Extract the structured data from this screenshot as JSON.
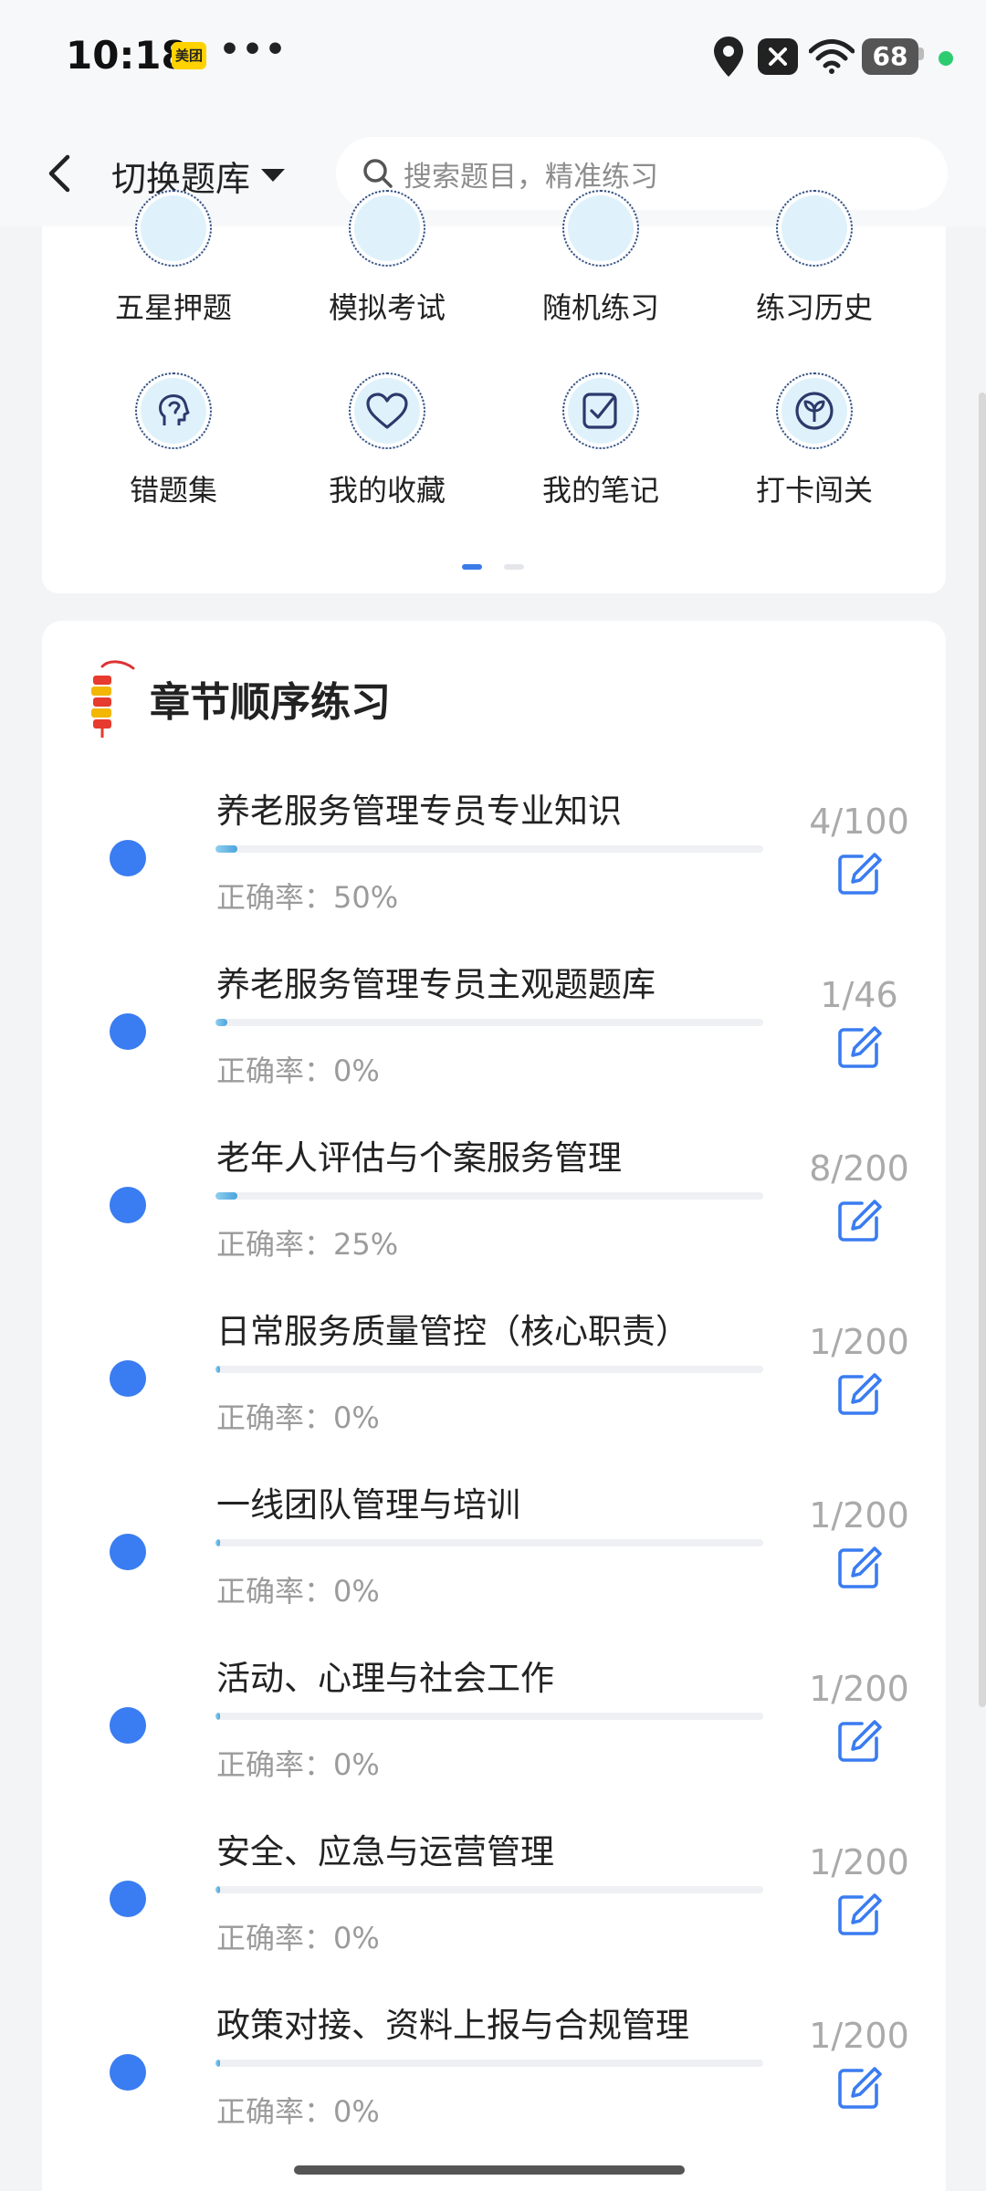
{
  "status_bar": {
    "time": "10:18",
    "meituan_badge": "美团",
    "more": "•••",
    "battery": "68"
  },
  "header": {
    "bank_switch_label": "切换题库",
    "search_placeholder": "搜索题目，精准练习"
  },
  "features": [
    {
      "label": "五星押题",
      "icon": "star-bank-icon"
    },
    {
      "label": "模拟考试",
      "icon": "mock-exam-icon"
    },
    {
      "label": "随机练习",
      "icon": "random-practice-icon"
    },
    {
      "label": "练习历史",
      "icon": "history-icon"
    },
    {
      "label": "错题集",
      "icon": "head-brain-icon"
    },
    {
      "label": "我的收藏",
      "icon": "heart-icon"
    },
    {
      "label": "我的笔记",
      "icon": "note-check-icon"
    },
    {
      "label": "打卡闯关",
      "icon": "leaf-check-icon"
    }
  ],
  "chapter_section": {
    "title": "章节顺序练习",
    "chapters": [
      {
        "name": "养老服务管理专员专业知识",
        "accuracy": "正确率：50%",
        "count": "4/100",
        "progress": 0.04
      },
      {
        "name": "养老服务管理专员主观题题库",
        "accuracy": "正确率：0%",
        "count": "1/46",
        "progress": 0.022
      },
      {
        "name": "老年人评估与个案服务管理",
        "accuracy": "正确率：25%",
        "count": "8/200",
        "progress": 0.04
      },
      {
        "name": "日常服务质量管控（核心职责）",
        "accuracy": "正确率：0%",
        "count": "1/200",
        "progress": 0.005
      },
      {
        "name": "一线团队管理与培训",
        "accuracy": "正确率：0%",
        "count": "1/200",
        "progress": 0.005
      },
      {
        "name": "活动、心理与社会工作",
        "accuracy": "正确率：0%",
        "count": "1/200",
        "progress": 0.005
      },
      {
        "name": "安全、应急与运营管理",
        "accuracy": "正确率：0%",
        "count": "1/200",
        "progress": 0.005
      },
      {
        "name": "政策对接、资料上报与合规管理",
        "accuracy": "正确率：0%",
        "count": "1/200",
        "progress": 0.005
      }
    ]
  },
  "colors": {
    "accent": "#3a7cf1",
    "icon_bg": "#dff2fb",
    "muted": "#9b9b9b"
  }
}
